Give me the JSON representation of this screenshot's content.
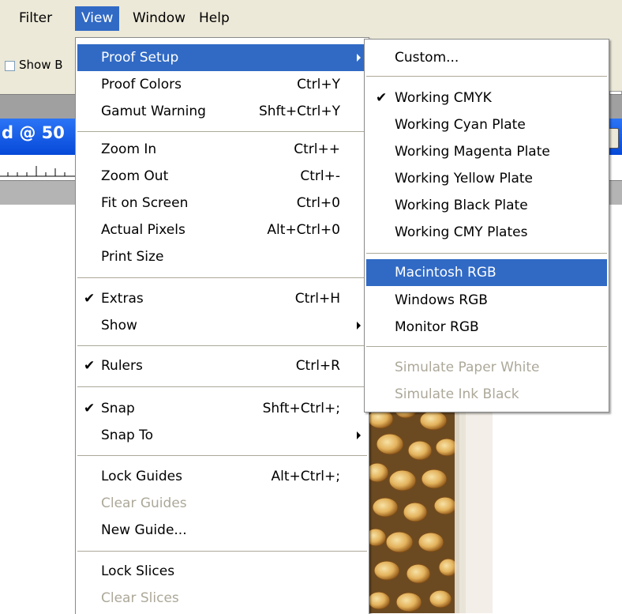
{
  "menubar": {
    "items": [
      {
        "label": "Filter"
      },
      {
        "label": "View"
      },
      {
        "label": "Window"
      },
      {
        "label": "Help"
      }
    ]
  },
  "options_bar": {
    "show_label": "Show B"
  },
  "document": {
    "title_fragment": "d @ 50"
  },
  "view_menu": {
    "items": [
      {
        "label": "Proof Setup",
        "shortcut": "",
        "checked": false,
        "submenu": true,
        "disabled": false
      },
      {
        "label": "Proof Colors",
        "shortcut": "Ctrl+Y",
        "checked": false,
        "submenu": false,
        "disabled": false
      },
      {
        "label": "Gamut Warning",
        "shortcut": "Shft+Ctrl+Y",
        "checked": false,
        "submenu": false,
        "disabled": false
      },
      {
        "label": "Zoom In",
        "shortcut": "Ctrl++",
        "checked": false,
        "submenu": false,
        "disabled": false
      },
      {
        "label": "Zoom Out",
        "shortcut": "Ctrl+-",
        "checked": false,
        "submenu": false,
        "disabled": false
      },
      {
        "label": "Fit on Screen",
        "shortcut": "Ctrl+0",
        "checked": false,
        "submenu": false,
        "disabled": false
      },
      {
        "label": "Actual Pixels",
        "shortcut": "Alt+Ctrl+0",
        "checked": false,
        "submenu": false,
        "disabled": false
      },
      {
        "label": "Print Size",
        "shortcut": "",
        "checked": false,
        "submenu": false,
        "disabled": false
      },
      {
        "label": "Extras",
        "shortcut": "Ctrl+H",
        "checked": true,
        "submenu": false,
        "disabled": false
      },
      {
        "label": "Show",
        "shortcut": "",
        "checked": false,
        "submenu": true,
        "disabled": false
      },
      {
        "label": "Rulers",
        "shortcut": "Ctrl+R",
        "checked": true,
        "submenu": false,
        "disabled": false
      },
      {
        "label": "Snap",
        "shortcut": "Shft+Ctrl+;",
        "checked": true,
        "submenu": false,
        "disabled": false
      },
      {
        "label": "Snap To",
        "shortcut": "",
        "checked": false,
        "submenu": true,
        "disabled": false
      },
      {
        "label": "Lock Guides",
        "shortcut": "Alt+Ctrl+;",
        "checked": false,
        "submenu": false,
        "disabled": false
      },
      {
        "label": "Clear Guides",
        "shortcut": "",
        "checked": false,
        "submenu": false,
        "disabled": true
      },
      {
        "label": "New Guide...",
        "shortcut": "",
        "checked": false,
        "submenu": false,
        "disabled": false
      },
      {
        "label": "Lock Slices",
        "shortcut": "",
        "checked": false,
        "submenu": false,
        "disabled": false
      },
      {
        "label": "Clear Slices",
        "shortcut": "",
        "checked": false,
        "submenu": false,
        "disabled": true
      }
    ]
  },
  "proof_menu": {
    "items": [
      {
        "label": "Custom...",
        "checked": false,
        "disabled": false
      },
      {
        "label": "Working CMYK",
        "checked": true,
        "disabled": false
      },
      {
        "label": "Working Cyan Plate",
        "checked": false,
        "disabled": false
      },
      {
        "label": "Working Magenta Plate",
        "checked": false,
        "disabled": false
      },
      {
        "label": "Working Yellow Plate",
        "checked": false,
        "disabled": false
      },
      {
        "label": "Working Black Plate",
        "checked": false,
        "disabled": false
      },
      {
        "label": "Working CMY Plates",
        "checked": false,
        "disabled": false
      },
      {
        "label": "Macintosh RGB",
        "checked": false,
        "disabled": false
      },
      {
        "label": "Windows RGB",
        "checked": false,
        "disabled": false
      },
      {
        "label": "Monitor RGB",
        "checked": false,
        "disabled": false
      },
      {
        "label": "Simulate Paper White",
        "checked": false,
        "disabled": true
      },
      {
        "label": "Simulate Ink Black",
        "checked": false,
        "disabled": true
      }
    ]
  },
  "colors": {
    "highlight": "#316ac5",
    "menu_bg": "#ffffff",
    "menubar_bg": "#ece9d8",
    "disabled_text": "#aca899",
    "title_bar": "#0a56e8"
  }
}
